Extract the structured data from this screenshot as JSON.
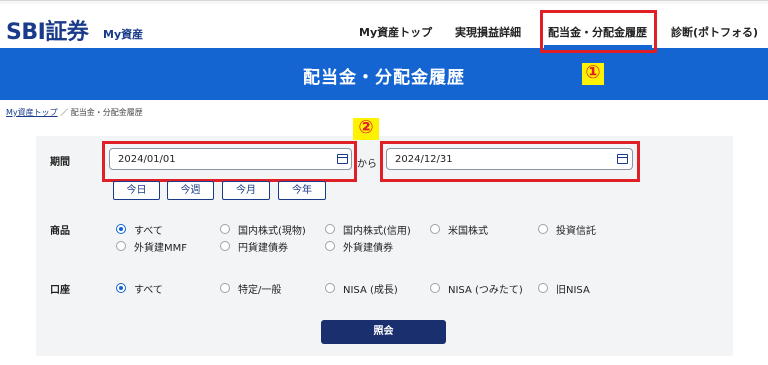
{
  "brand": {
    "logo": "SBI証券",
    "sub": "My資産"
  },
  "nav": {
    "items": [
      "My資産トップ",
      "実現損益詳細",
      "配当金・分配金履歴",
      "診断(ポトフォる)"
    ],
    "active_index": 2
  },
  "banner": {
    "title": "配当金・分配金履歴"
  },
  "breadcrumb": {
    "home": "My資産トップ",
    "separator": "／",
    "current": "配当金・分配金履歴"
  },
  "annotations": {
    "marker_1": "①",
    "marker_2": "②",
    "color": "#e01f26"
  },
  "period": {
    "label": "期間",
    "start": "2024/01/01",
    "connector": "から",
    "end": "2024/12/31",
    "quick": [
      "今日",
      "今週",
      "今月",
      "今年"
    ]
  },
  "product": {
    "label": "商品",
    "options": [
      "すべて",
      "国内株式(現物)",
      "国内株式(信用)",
      "米国株式",
      "投資信託",
      "外貨建MMF",
      "円貨建債券",
      "外貨建債券"
    ],
    "selected": "すべて"
  },
  "account": {
    "label": "口座",
    "options": [
      "すべて",
      "特定/一般",
      "NISA (成長)",
      "NISA (つみたて)",
      "旧NISA"
    ],
    "selected": "すべて"
  },
  "submit_label": "照会",
  "colors": {
    "brand_blue": "#1464d2",
    "dark_navy": "#1a2f6e",
    "panel_bg": "#f3f4f5"
  }
}
